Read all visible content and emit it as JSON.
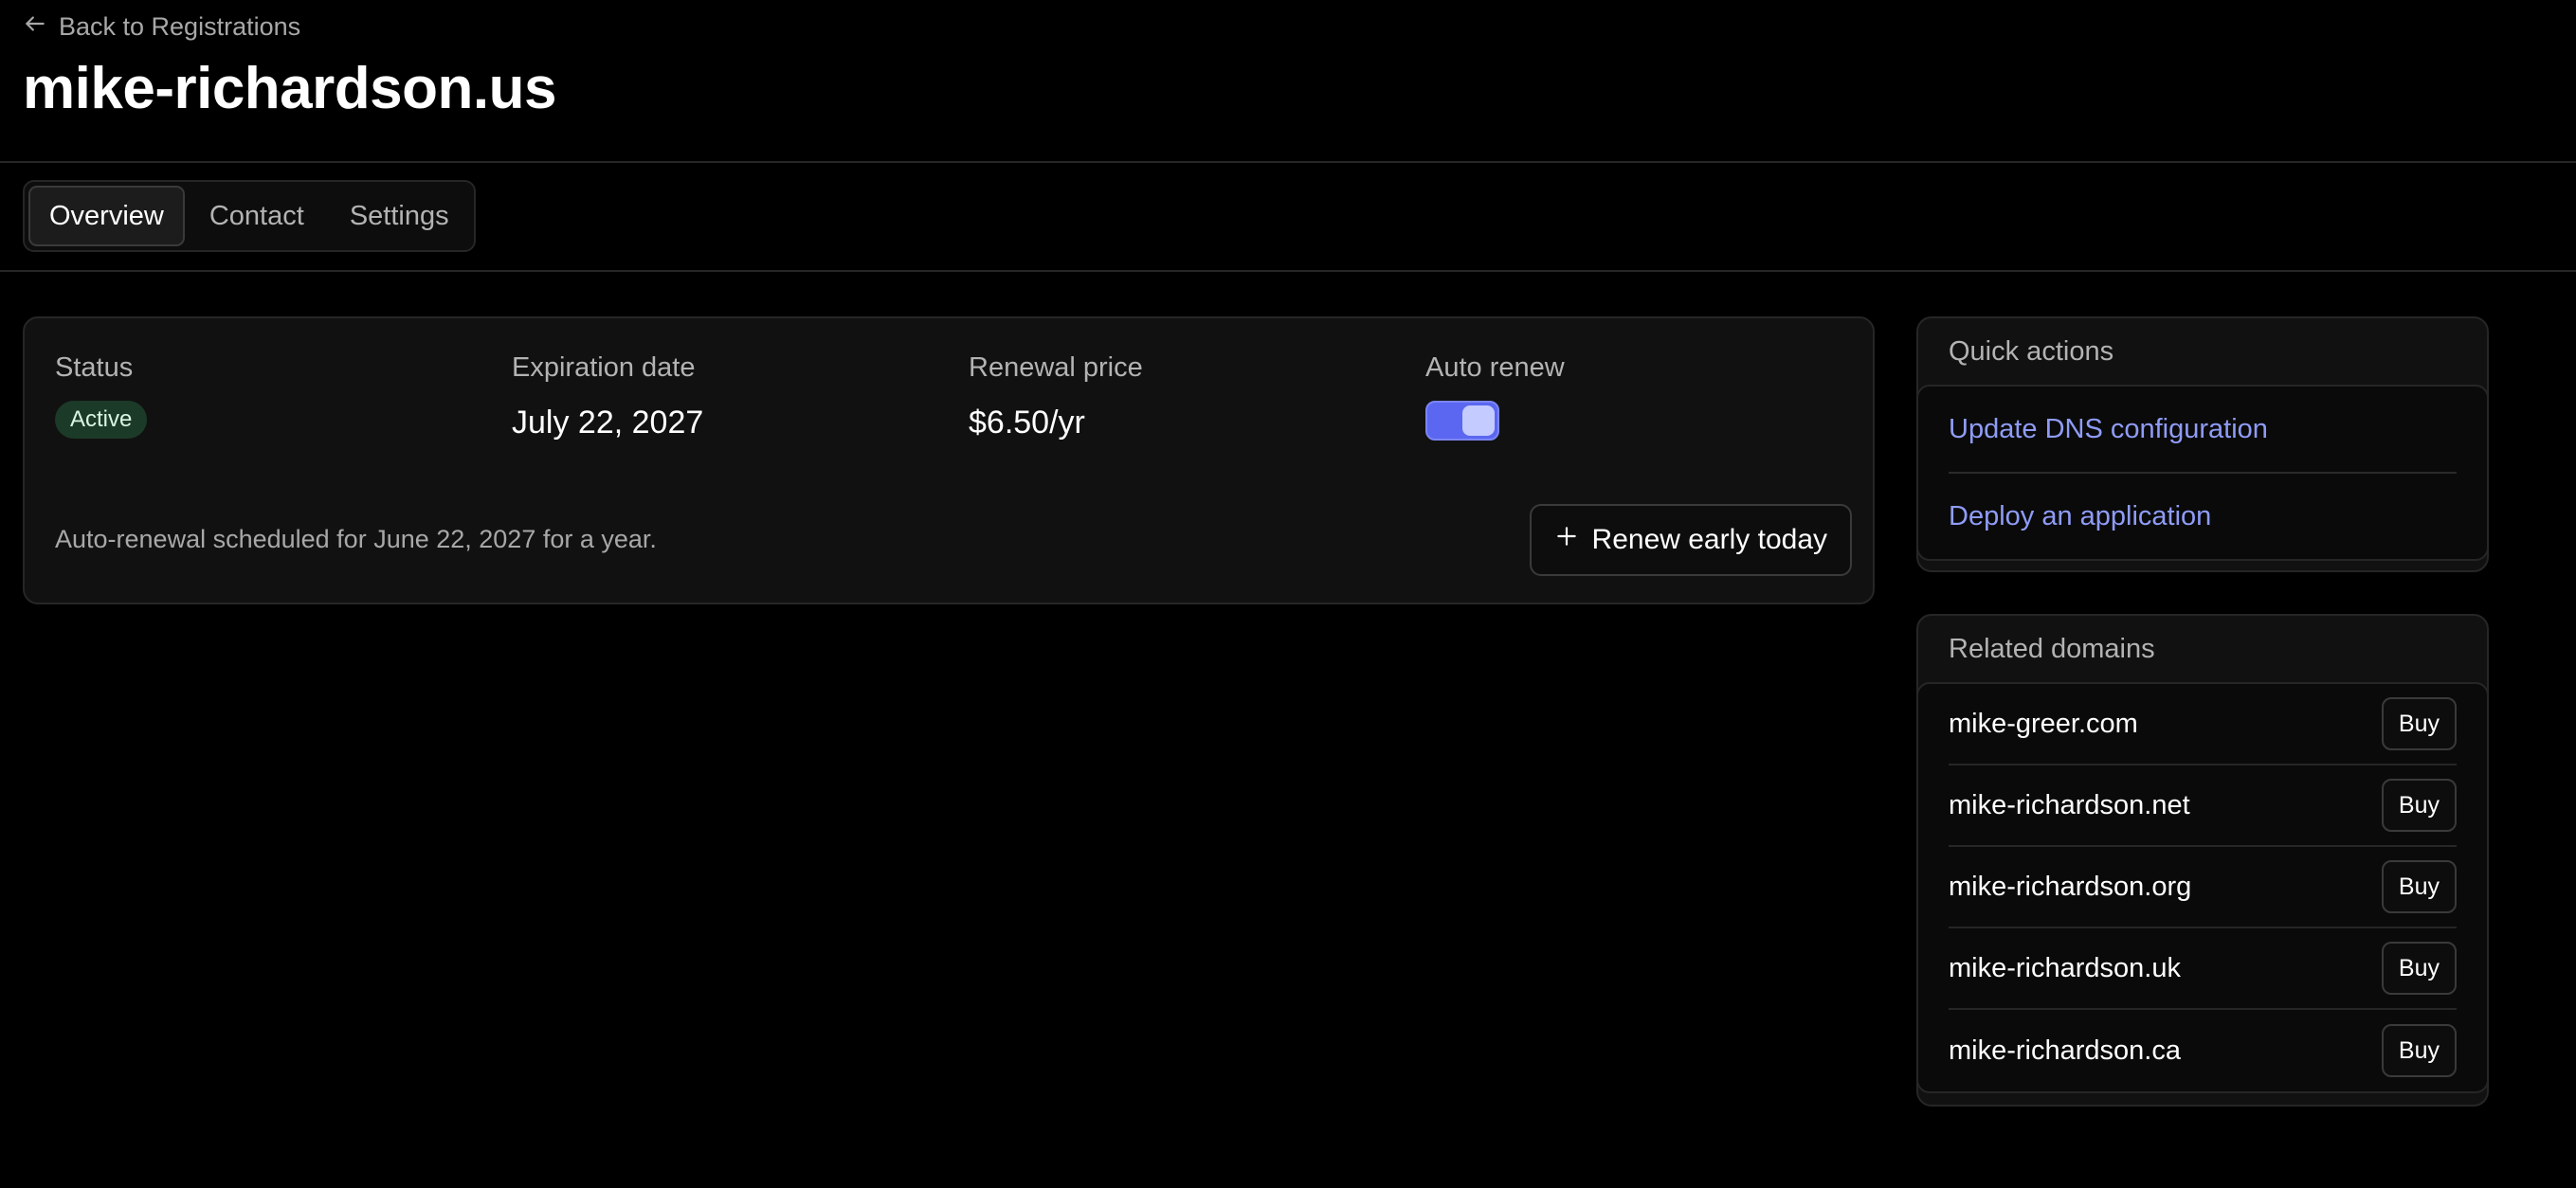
{
  "header": {
    "back_label": "Back to Registrations",
    "title": "mike-richardson.us"
  },
  "tabs": [
    {
      "label": "Overview",
      "active": true
    },
    {
      "label": "Contact",
      "active": false
    },
    {
      "label": "Settings",
      "active": false
    }
  ],
  "overview": {
    "status_label": "Status",
    "status_value": "Active",
    "expiration_label": "Expiration date",
    "expiration_value": "July 22, 2027",
    "price_label": "Renewal price",
    "price_value": "$6.50/yr",
    "auto_renew_label": "Auto renew",
    "auto_renew_enabled": true,
    "renewal_note": "Auto-renewal scheduled for June 22, 2027 for a year.",
    "renew_button_label": "Renew early today"
  },
  "quick_actions": {
    "title": "Quick actions",
    "items": [
      {
        "label": "Update DNS configuration"
      },
      {
        "label": "Deploy an application"
      }
    ]
  },
  "related_domains": {
    "title": "Related domains",
    "buy_label": "Buy",
    "items": [
      {
        "name": "mike-greer.com"
      },
      {
        "name": "mike-richardson.net"
      },
      {
        "name": "mike-richardson.org"
      },
      {
        "name": "mike-richardson.uk"
      },
      {
        "name": "mike-richardson.ca"
      }
    ]
  },
  "colors": {
    "background": "#000000",
    "accent": "#5b67f0",
    "link": "#8f9cf7",
    "badge_bg": "#1c3a28"
  },
  "icons": {
    "back": "arrow-left-icon",
    "renew": "plus-icon"
  }
}
